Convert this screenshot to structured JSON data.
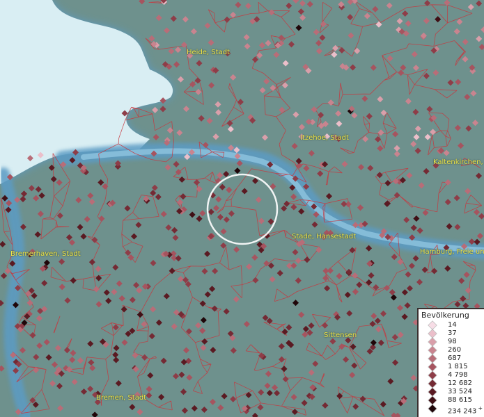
{
  "map": {
    "cities": [
      {
        "id": "heide",
        "name": "Heide, Stadt"
      },
      {
        "id": "itzehoe",
        "name": "Itzehoe, Stadt"
      },
      {
        "id": "kaltenkirchen",
        "name": "Kaltenkirchen, S"
      },
      {
        "id": "stade",
        "name": "Stade, Hansestadt"
      },
      {
        "id": "bremerhaven",
        "name": "Bremerhaven, Stadt"
      },
      {
        "id": "hamburg",
        "name": "Hamburg, Freie und"
      },
      {
        "id": "sittensen",
        "name": "Sittensen"
      },
      {
        "id": "bremen",
        "name": "Bremen, Stadt"
      }
    ],
    "colors": {
      "land": "#6e918d",
      "sea": "#d9eef3",
      "river": "#5b9bc4",
      "boundary": "#c8363d",
      "label": "#f0e84a",
      "focus_ring": "#ffffff"
    }
  },
  "legend": {
    "title": "Bevölkerung",
    "open_ended_marker": "+",
    "classes": [
      {
        "label": "14",
        "color": "#f7dde6"
      },
      {
        "label": "37",
        "color": "#ebbfca"
      },
      {
        "label": "98",
        "color": "#d99faa"
      },
      {
        "label": "260",
        "color": "#c9848f"
      },
      {
        "label": "687",
        "color": "#b86d78"
      },
      {
        "label": "1 815",
        "color": "#a6545f"
      },
      {
        "label": "4 798",
        "color": "#8e3d48"
      },
      {
        "label": "12 682",
        "color": "#742a34"
      },
      {
        "label": "33 524",
        "color": "#5a1a22"
      },
      {
        "label": "88 615",
        "color": "#3f0f15"
      },
      {
        "label": "234 243",
        "color": "#1f0609"
      }
    ]
  }
}
